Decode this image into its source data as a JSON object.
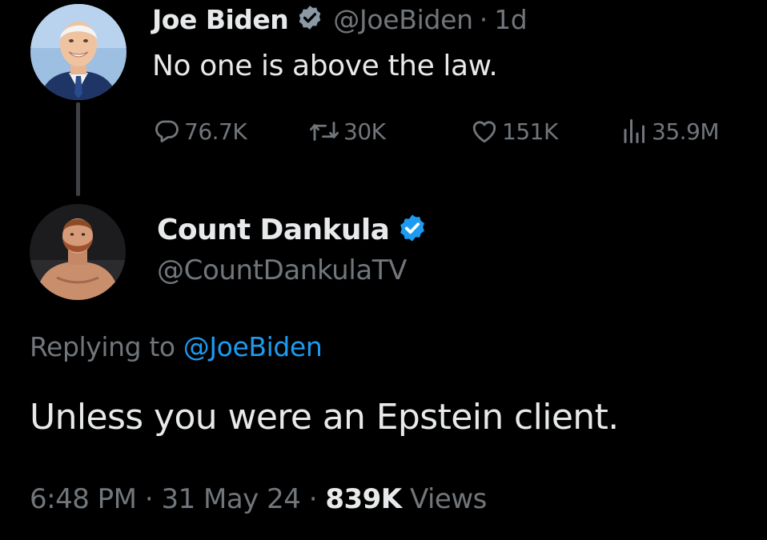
{
  "parent_tweet": {
    "author_name": "Joe Biden",
    "handle": "@JoeBiden",
    "separator": "·",
    "time_ago": "1d",
    "text": "No one is above the law.",
    "stats": {
      "replies": "76.7K",
      "reposts": "30K",
      "likes": "151K",
      "views": "35.9M"
    }
  },
  "reply_tweet": {
    "author_name": "Count Dankula",
    "handle": "@CountDankulaTV",
    "replying_prefix": "Replying to",
    "replying_to": "@JoeBiden",
    "text": "Unless you were an Epstein client.",
    "meta": {
      "time": "6:48 PM",
      "separator": "·",
      "date": "31 May 24",
      "views_count": "839K",
      "views_label": "Views"
    }
  },
  "icons": {
    "verified": "verified-badge-icon",
    "reply": "reply-bubble-icon",
    "repost": "repost-arrows-icon",
    "like": "heart-icon",
    "views": "bar-chart-icon"
  },
  "colors": {
    "background": "#000000",
    "primary_text": "#e7e9ea",
    "secondary_text": "#71767b",
    "accent_blue": "#1d9bf0",
    "thread_line": "#3e4144",
    "parent_badge": "#8b98a5"
  }
}
